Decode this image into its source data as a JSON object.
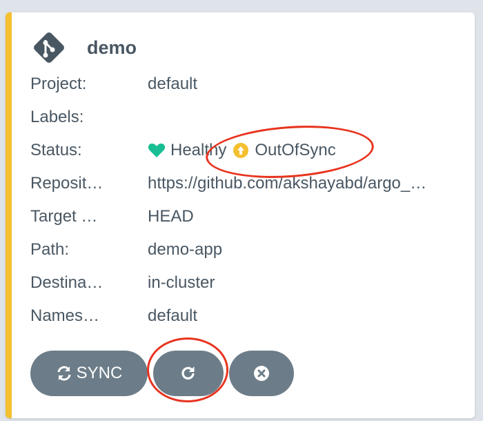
{
  "app": {
    "name": "demo",
    "icon": "git-diamond-icon"
  },
  "fields": [
    {
      "label": "Project:",
      "value": "default"
    },
    {
      "label": "Labels:",
      "value": ""
    },
    {
      "label": "Status:",
      "health": "Healthy",
      "sync": "OutOfSync"
    },
    {
      "label": "Reposit…",
      "value": "https://github.com/akshayabd/argo_…"
    },
    {
      "label": "Target …",
      "value": "HEAD"
    },
    {
      "label": "Path:",
      "value": "demo-app"
    },
    {
      "label": "Destina…",
      "value": "in-cluster"
    },
    {
      "label": "Names…",
      "value": "default"
    }
  ],
  "actions": {
    "sync_label": "SYNC",
    "refresh_icon": "refresh-icon",
    "delete_icon": "close-circle-icon"
  },
  "colors": {
    "accent_bar": "#f4c030",
    "healthy": "#18be94",
    "out_of_sync": "#f4c030",
    "button_bg": "#6c7d89",
    "annotation": "#e8331e",
    "text": "#495763"
  }
}
